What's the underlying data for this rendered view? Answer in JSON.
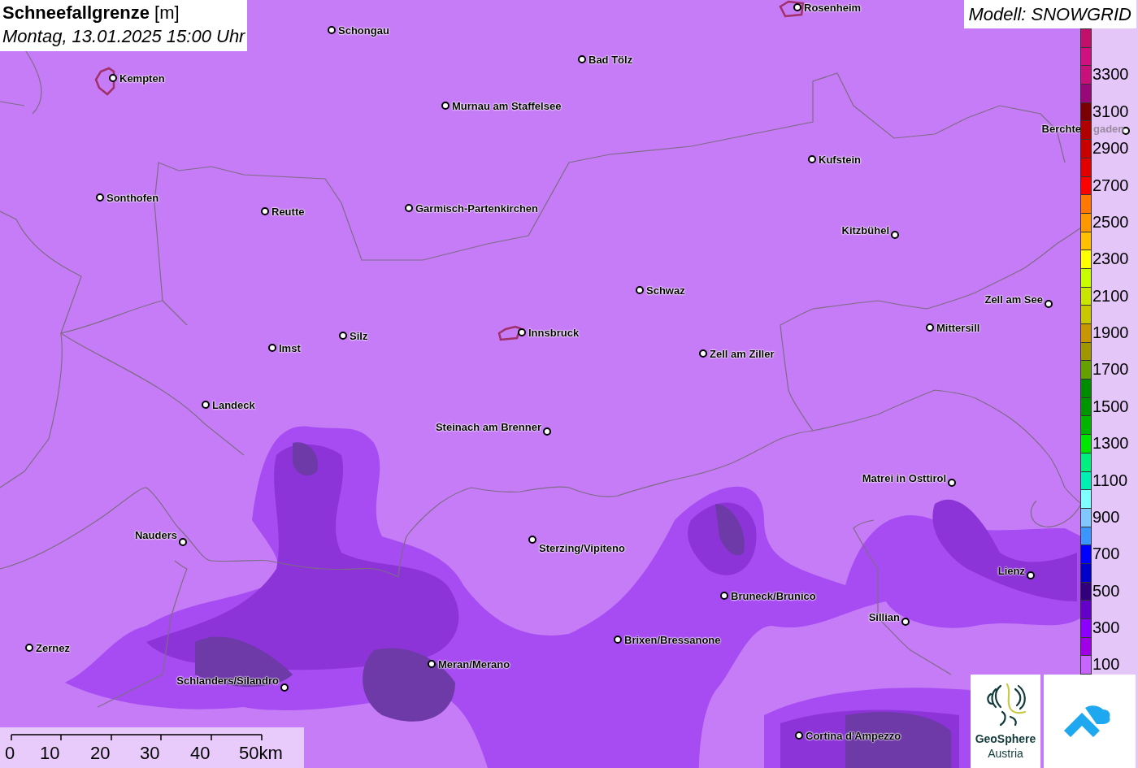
{
  "title": {
    "main": "**Schneefallgrenze** [m]",
    "subtitle": "Montag, 13.01.2025 15:00 Uhr"
  },
  "model": "Modell: SNOWGRID",
  "cities": [
    {
      "name": "Rosenheim"
    },
    {
      "name": "Schongau"
    },
    {
      "name": "Bad Tölz"
    },
    {
      "name": "Kempten"
    },
    {
      "name": "Murnau am Staffelsee"
    },
    {
      "name": "Berchte",
      "name_faded": "gaden"
    },
    {
      "name": "Kufstein"
    },
    {
      "name": "Sonthofen"
    },
    {
      "name": "Reutte"
    },
    {
      "name": "Garmisch-Partenkirchen"
    },
    {
      "name": "Kitzbühel"
    },
    {
      "name": "Schwaz"
    },
    {
      "name": "Zell am See"
    },
    {
      "name": "Mittersill"
    },
    {
      "name": "Innsbruck"
    },
    {
      "name": "Silz"
    },
    {
      "name": "Imst"
    },
    {
      "name": "Zell am Ziller"
    },
    {
      "name": "Landeck"
    },
    {
      "name": "Steinach am Brenner"
    },
    {
      "name": "Matrei in Osttirol"
    },
    {
      "name": "Nauders"
    },
    {
      "name": "Sterzing/Vipiteno"
    },
    {
      "name": "Lienz"
    },
    {
      "name": "Bruneck/Brunico"
    },
    {
      "name": "Sillian"
    },
    {
      "name": "Brixen/Bressanone"
    },
    {
      "name": "Zernez"
    },
    {
      "name": "Meran/Merano"
    },
    {
      "name": "Schlanders/Silandro"
    },
    {
      "name": "Cortina d'Ampezzo"
    }
  ],
  "legend": [
    {
      "color": "#c0106a"
    },
    {
      "color": "#d01080"
    },
    {
      "color": "#c8107a",
      "label": "3300"
    },
    {
      "color": "#980878"
    },
    {
      "color": "#780000",
      "label": "3100"
    },
    {
      "color": "#b00000"
    },
    {
      "color": "#c80000",
      "label": "2900"
    },
    {
      "color": "#e00000"
    },
    {
      "color": "#ff0000",
      "label": "2700"
    },
    {
      "color": "#ff7800"
    },
    {
      "color": "#ff9800",
      "label": "2500"
    },
    {
      "color": "#ffc000"
    },
    {
      "color": "#ffff00",
      "label": "2300"
    },
    {
      "color": "#c8ff00"
    },
    {
      "color": "#c8e600",
      "label": "2100"
    },
    {
      "color": "#c8c800"
    },
    {
      "color": "#c89600",
      "label": "1900"
    },
    {
      "color": "#a09600"
    },
    {
      "color": "#64a000",
      "label": "1700"
    },
    {
      "color": "#008c00"
    },
    {
      "color": "#009600",
      "label": "1500"
    },
    {
      "color": "#00b400"
    },
    {
      "color": "#00e600",
      "label": "1300"
    },
    {
      "color": "#00f080"
    },
    {
      "color": "#00f0b4",
      "label": "1100"
    },
    {
      "color": "#80ffff"
    },
    {
      "color": "#80c8ff",
      "label": "900"
    },
    {
      "color": "#3c96ff"
    },
    {
      "color": "#0000ff",
      "label": "700"
    },
    {
      "color": "#0000c8"
    },
    {
      "color": "#32007a",
      "label": "500"
    },
    {
      "color": "#6400c8"
    },
    {
      "color": "#8c00ff",
      "label": "300"
    },
    {
      "color": "#a000e6"
    },
    {
      "color": "#c864ff",
      "label": "100"
    }
  ],
  "scale_bar": {
    "ticks": [
      "0",
      "10",
      "20",
      "30",
      "40",
      "50km"
    ]
  },
  "logos": {
    "name": "GeoSphere",
    "subname": "Austria"
  }
}
